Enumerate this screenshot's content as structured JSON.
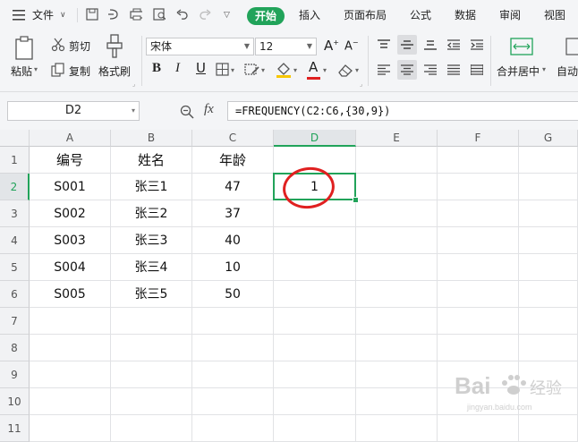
{
  "menubar": {
    "menu_icon": "hamburger-icon",
    "file_label": "文件",
    "tabs": [
      "开始",
      "插入",
      "页面布局",
      "公式",
      "数据",
      "审阅",
      "视图"
    ],
    "active_tab": "开始"
  },
  "ribbon": {
    "paste_label": "粘贴",
    "cut_label": "剪切",
    "copy_label": "复制",
    "format_painter_label": "格式刷",
    "font_name": "宋体",
    "font_size": "12",
    "bold": "B",
    "italic": "I",
    "underline": "U",
    "font_color_letter": "A",
    "grow_font": "A",
    "shrink_font": "A",
    "merge_center_label": "合并居中",
    "auto_wrap_label": "自动"
  },
  "formulabar": {
    "name_box": "D2",
    "fx_label": "fx",
    "formula": "=FREQUENCY(C2:C6,{30,9})"
  },
  "grid": {
    "columns": [
      "A",
      "B",
      "C",
      "D",
      "E",
      "F",
      "G"
    ],
    "active_column": "D",
    "rows": [
      "1",
      "2",
      "3",
      "4",
      "5",
      "6",
      "7",
      "8",
      "9",
      "10",
      "11"
    ],
    "active_row": "2",
    "header_row": [
      "编号",
      "姓名",
      "年龄"
    ],
    "data_rows": [
      [
        "S001",
        "张三1",
        "47"
      ],
      [
        "S002",
        "张三2",
        "37"
      ],
      [
        "S003",
        "张三3",
        "40"
      ],
      [
        "S004",
        "张三4",
        "10"
      ],
      [
        "S005",
        "张三5",
        "50"
      ]
    ],
    "d2_value": "1"
  },
  "watermark": {
    "brand": "Bai",
    "brand2": "经验",
    "url": "jingyan.baidu.com"
  },
  "colors": {
    "accent": "#21a35a",
    "annotation": "#e02020"
  }
}
